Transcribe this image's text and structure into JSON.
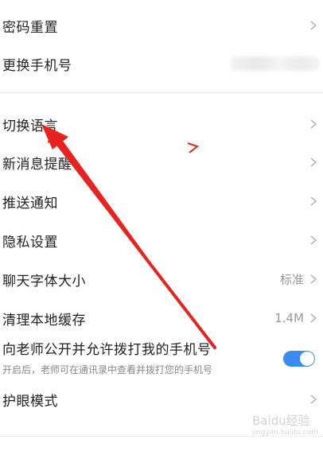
{
  "settings": {
    "password_reset": "密码重置",
    "change_phone": "更换手机号",
    "switch_language": "切换语言",
    "new_message_reminder": "新消息提醒",
    "push_notification": "推送通知",
    "privacy_settings": "隐私设置",
    "chat_font_size": {
      "label": "聊天字体大小",
      "value": "标准"
    },
    "clear_cache": {
      "label": "清理本地缓存",
      "value": "1.4M"
    },
    "public_phone": {
      "label": "向老师公开并允许拨打我的手机号",
      "description": "开启后，老师可在通讯录中查看并拨打您的手机号",
      "enabled": true
    },
    "eye_protection": "护眼模式"
  },
  "watermark": {
    "text": "Baidu经验",
    "sub": "jingyan.baidu.com"
  },
  "colors": {
    "toggle_on": "#3d8bf0",
    "annotation_arrow": "#e8231f"
  }
}
